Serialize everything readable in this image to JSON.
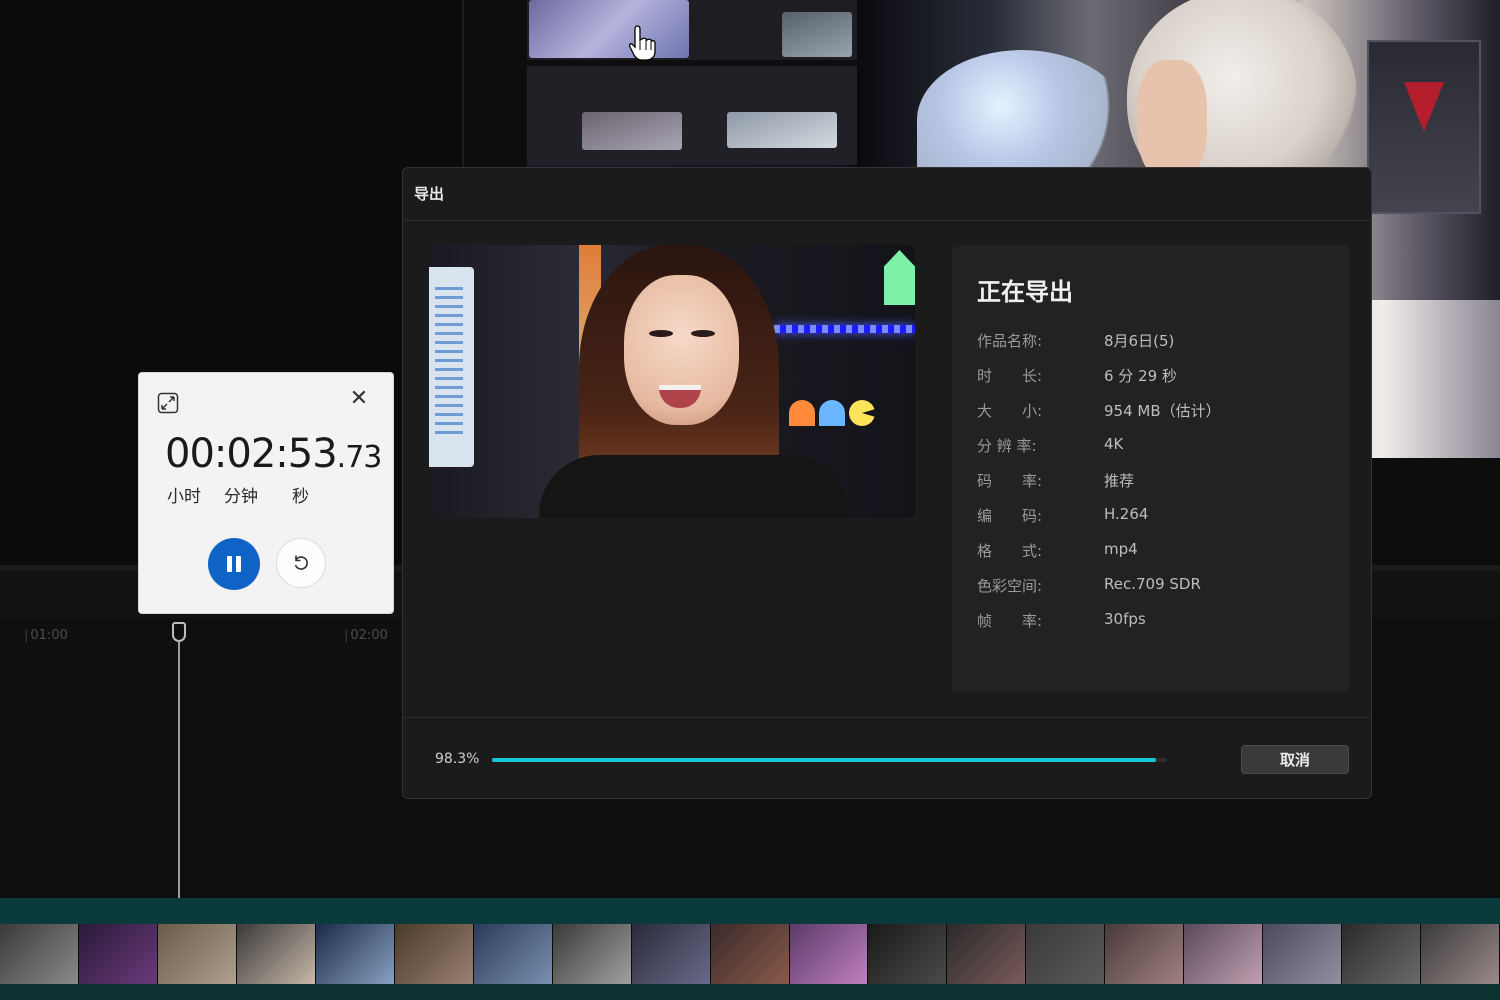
{
  "timeline": {
    "ticks": [
      "01:00",
      "02:00"
    ]
  },
  "export_dialog": {
    "title": "导出",
    "status_heading": "正在导出",
    "info": [
      {
        "label": "作品名称:",
        "value": "8月6日(5)"
      },
      {
        "label": "时　　长:",
        "value": "6 分 29 秒"
      },
      {
        "label": "大　　小:",
        "value": "954 MB（估计）"
      },
      {
        "label": "分 辨 率:",
        "value": "4K"
      },
      {
        "label": "码　　率:",
        "value": "推荐"
      },
      {
        "label": "编　　码:",
        "value": "H.264"
      },
      {
        "label": "格　　式:",
        "value": "mp4"
      },
      {
        "label": "色彩空间:",
        "value": "Rec.709 SDR"
      },
      {
        "label": "帧　　率:",
        "value": "30fps"
      }
    ],
    "progress_text": "98.3%",
    "progress_fraction": 0.983,
    "cancel_label": "取消",
    "accent_color": "#19c6d6"
  },
  "stopwatch": {
    "time_main": "00:02:53",
    "time_fraction": ".73",
    "unit_hours": "小时",
    "unit_minutes": "分钟",
    "unit_seconds": "秒",
    "pause_icon": "pause-icon",
    "reset_icon": "reset-icon",
    "accent_color": "#0f62c6"
  }
}
